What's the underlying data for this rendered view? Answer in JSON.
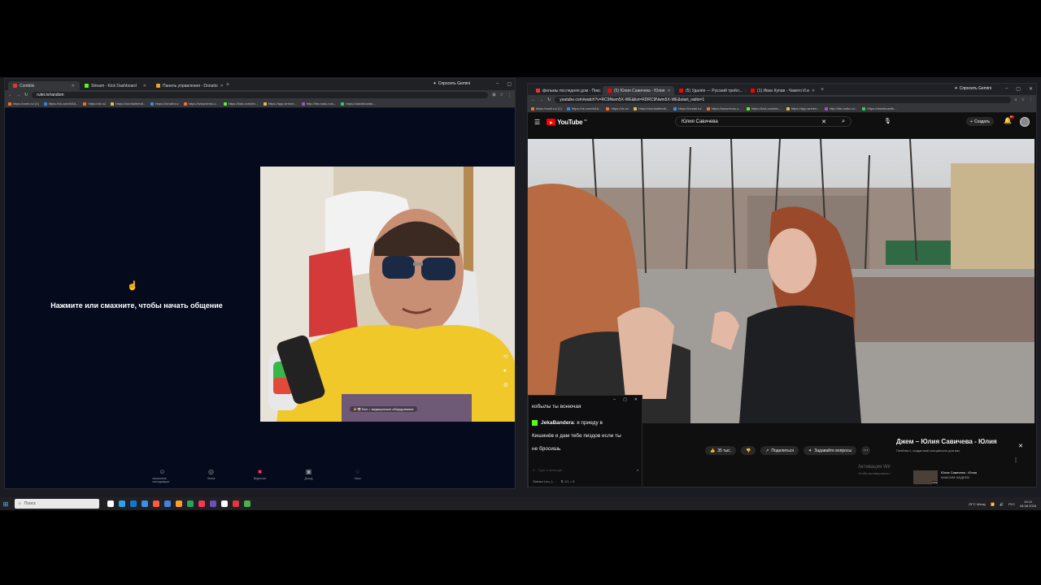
{
  "left_window": {
    "tabs": [
      {
        "label": "Combile",
        "color": "#e2363f",
        "active": true
      },
      {
        "label": "Stream - Kick Dashboard",
        "color": "#53fc18",
        "active": false
      },
      {
        "label": "Панель управления - Donatio",
        "color": "#f0a030",
        "active": false
      }
    ],
    "gemini_label": "Спросить Gemini",
    "url": "rulet.tv/random",
    "bookmarks": [
      "https://vseli.ru/ (1)",
      "https://vk.com/id16...",
      "https://vk.ru/",
      "https://worldofteedi...",
      "https://ionabl.ru/",
      "https://www.temu.c...",
      "https://kick.com/lec...",
      "https://app.wrenm...",
      "http://lite-radio.ru/s...",
      "https://dashboardk..."
    ],
    "prompt": "Нажмите или смахните, чтобы начать общение",
    "cam_overlay": "⚡👁 Все    ○ медицинское оборудование",
    "nav": [
      {
        "label": "начальное инструмкция",
        "icon": "person",
        "active": false
      },
      {
        "label": "Лента",
        "icon": "feed",
        "active": false
      },
      {
        "label": "Видеочат",
        "icon": "video",
        "active": true
      },
      {
        "label": "Доход",
        "icon": "wallet",
        "active": false
      },
      {
        "label": "Чаты",
        "icon": "chat",
        "active": false
      }
    ]
  },
  "right_window": {
    "tabs": [
      {
        "label": "фильмы последняя дом - Пикс",
        "color": "#e2363f",
        "active": false
      },
      {
        "label": "(5) Юлия Савичева - Юлия",
        "color": "#ff0000",
        "active": true
      },
      {
        "label": "(5) Удалёе — Русский трейл...",
        "color": "#ff0000",
        "active": false
      },
      {
        "label": "(1) Иван Купав - Чакито И.и",
        "color": "#ff0000",
        "active": false
      }
    ],
    "gemini_label": "Спросить Gemini",
    "url": "youtube.com/watch?v=RC9Nwm5X-WE&list=RDRC9Nwm5X-WE&start_radio=1",
    "bookmarks": [
      "https://vseli.ru/ (1)",
      "https://vk.com/id16...",
      "https://vk.ru/",
      "https://worldofteedi...",
      "https://ionabl.ru/",
      "https://www.temu.c...",
      "https://kick.com/lec...",
      "https://app.wrenm...",
      "http://lite-radio.ru/...",
      "https://dashboardk..."
    ],
    "yt_logo": "YouTube",
    "yt_region": "RU",
    "search_value": "Юлия Савичева",
    "create_label": "Создать",
    "bell_count": "9+",
    "like_count": "35 тыс.",
    "share_label": "Поделиться",
    "ask_label": "Задавайте вопросы",
    "chat": {
      "line1": "кобылы ты вонючая",
      "user": "JekaBandera",
      "line2": ": я приеду в",
      "line3": "Кишинёв и дам тебе пиздов если ты",
      "line4": "не бросишь",
      "input_placeholder": "Type a message...",
      "footer_name": "Stream Leo_L...",
      "footer_stats": "⇅ 1/1    ○ 5"
    },
    "mix": {
      "title": "Джем – Юлия Савичева - Юлия",
      "subtitle": "Плейлист, созданный специально для вас",
      "item_title": "Юлия Савичева - Юлия",
      "item_artist": "МАКСИМ ФАДЕЕВ",
      "item_duration": "3:53"
    },
    "activate_windows": "Активация Windows",
    "activate_sub": "Чтобы активировать Windows, перейдите в раздел..."
  },
  "taskbar": {
    "search_placeholder": "Поиск",
    "weather": "23°C  Windy",
    "lang": "РУС",
    "time": "19:10",
    "date": "08.08.2026",
    "icon_colors": [
      "#ffffff",
      "#2aa3ef",
      "#0f78d4",
      "#3b8eea",
      "#ff5a3c",
      "#3f82e0",
      "#ff9e2c",
      "#26a65b",
      "#ff3355",
      "#6b4fbb",
      "#ffffff",
      "#e2363f",
      "#4caf50"
    ]
  }
}
